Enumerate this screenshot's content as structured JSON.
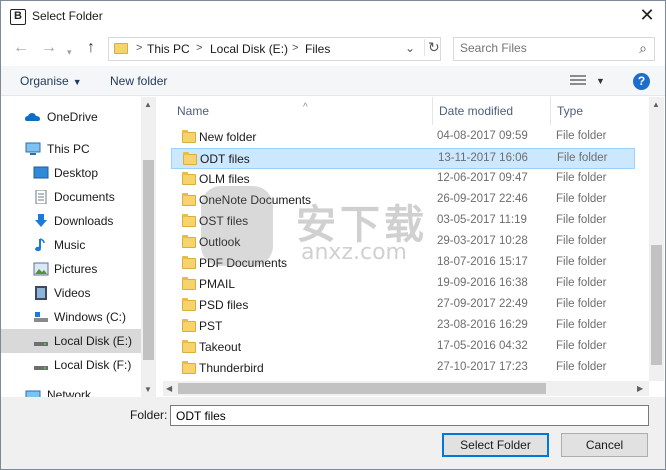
{
  "window": {
    "title": "Select Folder",
    "app_icon_letter": "B",
    "close_glyph": "✕"
  },
  "address_bar": {
    "crumbs": [
      "This PC",
      "Local Disk (E:)",
      "Files"
    ],
    "separator": ">"
  },
  "search": {
    "placeholder": "Search Files"
  },
  "toolbar": {
    "organise": "Organise",
    "new_folder": "New folder",
    "help": "?"
  },
  "nav_pane": {
    "items": [
      {
        "label": "OneDrive",
        "icon": "onedrive-icon"
      },
      {
        "label": "This PC",
        "icon": "this-pc-icon"
      },
      {
        "label": "Desktop",
        "icon": "desktop-icon"
      },
      {
        "label": "Documents",
        "icon": "documents-icon"
      },
      {
        "label": "Downloads",
        "icon": "downloads-icon"
      },
      {
        "label": "Music",
        "icon": "music-icon"
      },
      {
        "label": "Pictures",
        "icon": "pictures-icon"
      },
      {
        "label": "Videos",
        "icon": "videos-icon"
      },
      {
        "label": "Windows (C:)",
        "icon": "drive-icon"
      },
      {
        "label": "Local Disk (E:)",
        "icon": "drive-icon",
        "selected": true
      },
      {
        "label": "Local Disk (F:)",
        "icon": "drive-icon"
      },
      {
        "label": "Network",
        "icon": "network-icon"
      }
    ]
  },
  "columns": {
    "name": "Name",
    "date": "Date modified",
    "type": "Type"
  },
  "files": [
    {
      "name": "New folder",
      "date": "04-08-2017 09:59",
      "type": "File folder"
    },
    {
      "name": "ODT files",
      "date": "13-11-2017 16:06",
      "type": "File folder",
      "selected": true
    },
    {
      "name": "OLM files",
      "date": "12-06-2017 09:47",
      "type": "File folder"
    },
    {
      "name": "OneNote Documents",
      "date": "26-09-2017 22:46",
      "type": "File folder"
    },
    {
      "name": "OST files",
      "date": "03-05-2017 11:19",
      "type": "File folder"
    },
    {
      "name": "Outlook",
      "date": "29-03-2017 10:28",
      "type": "File folder"
    },
    {
      "name": "PDF Documents",
      "date": "18-07-2016 15:17",
      "type": "File folder"
    },
    {
      "name": "PMAIL",
      "date": "19-09-2016 16:38",
      "type": "File folder"
    },
    {
      "name": "PSD files",
      "date": "27-09-2017 22:49",
      "type": "File folder"
    },
    {
      "name": "PST",
      "date": "23-08-2016 16:29",
      "type": "File folder"
    },
    {
      "name": "Takeout",
      "date": "17-05-2016 04:32",
      "type": "File folder"
    },
    {
      "name": "Thunderbird",
      "date": "27-10-2017 17:23",
      "type": "File folder"
    }
  ],
  "footer": {
    "folder_label": "Folder:",
    "folder_value": "ODT files",
    "select_button": "Select Folder",
    "cancel_button": "Cancel"
  },
  "watermark": {
    "text": "安下载",
    "sub": "anxz.com"
  },
  "colors": {
    "selection": "#cce8ff",
    "accent": "#0078d7",
    "help": "#1c6fc8",
    "folder": "#f6d36b"
  }
}
